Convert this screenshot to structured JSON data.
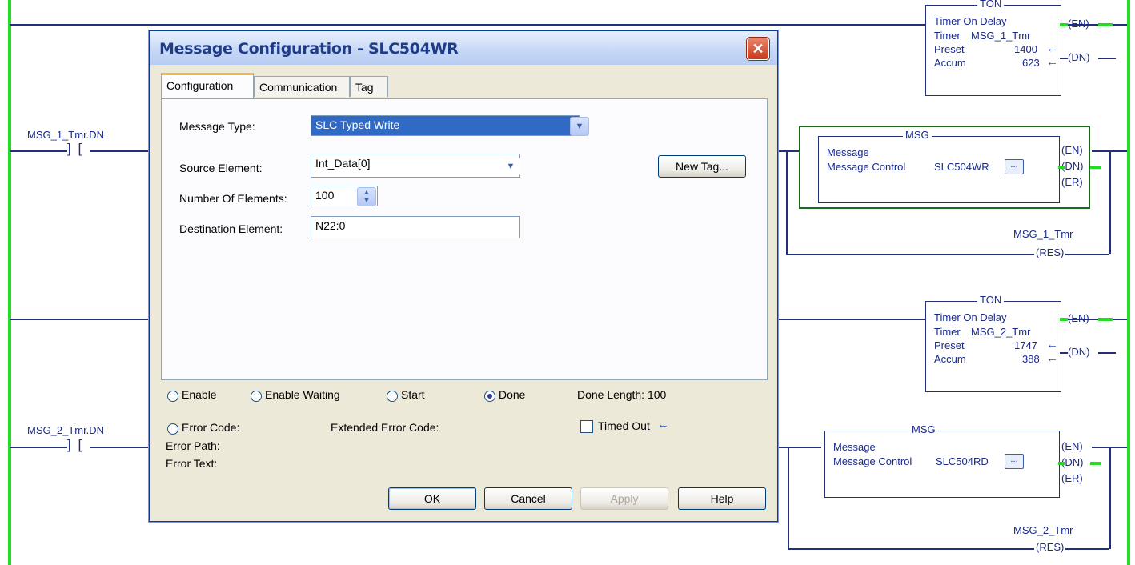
{
  "ladder": {
    "rung1_contact_label": "MSG_1_Tmr.DN",
    "rung2_contact_label": "MSG_2_Tmr.DN",
    "contact_symbol": "] [",
    "ton1": {
      "header": "TON",
      "title": "Timer On Delay",
      "timer_label": "Timer",
      "timer_tag": "MSG_1_Tmr",
      "preset_label": "Preset",
      "preset_value": "1400",
      "accum_label": "Accum",
      "accum_value": "623",
      "en": "(EN)",
      "dn": "(DN)"
    },
    "msg1": {
      "header": "MSG",
      "title": "Message",
      "control_label": "Message Control",
      "control_tag": "SLC504WR",
      "en": "(EN)",
      "dn": "(DN)",
      "er": "(ER)",
      "res_tag": "MSG_1_Tmr",
      "res": "(RES)"
    },
    "ton2": {
      "header": "TON",
      "title": "Timer On Delay",
      "timer_label": "Timer",
      "timer_tag": "MSG_2_Tmr",
      "preset_label": "Preset",
      "preset_value": "1747",
      "accum_label": "Accum",
      "accum_value": "388",
      "en": "(EN)",
      "dn": "(DN)"
    },
    "msg2": {
      "header": "MSG",
      "title": "Message",
      "control_label": "Message Control",
      "control_tag": "SLC504RD",
      "en": "(EN)",
      "dn": "(DN)",
      "er": "(ER)",
      "res_tag": "MSG_2_Tmr",
      "res": "(RES)"
    },
    "ellipsis_label": "..."
  },
  "dialog": {
    "title": "Message Configuration - SLC504WR",
    "close_glyph": "✕",
    "tabs": [
      "Configuration",
      "Communication",
      "Tag"
    ],
    "active_tab": "Configuration",
    "message_type_label": "Message Type:",
    "message_type_value": "SLC Typed Write",
    "source_element_label": "Source Element:",
    "source_element_value": "Int_Data[0]",
    "new_tag_button": "New Tag...",
    "number_of_elements_label": "Number Of Elements:",
    "number_of_elements_value": "100",
    "destination_element_label": "Destination Element:",
    "destination_element_value": "N22:0",
    "status": {
      "enable": "Enable",
      "enable_waiting": "Enable Waiting",
      "start": "Start",
      "done": "Done",
      "done_selected": true,
      "done_length": "Done Length: 100",
      "error_code": "Error Code:",
      "extended_error_code": "Extended Error Code:",
      "timed_out": "Timed Out",
      "error_path": "Error Path:",
      "error_text": "Error Text:"
    },
    "buttons": {
      "ok": "OK",
      "cancel": "Cancel",
      "apply": "Apply",
      "help": "Help"
    }
  },
  "colors": {
    "rail_green": "#22dd22",
    "wire_blue": "#22307a",
    "msg_highlight_box": "#1a6a1a",
    "tab_accent": "#f7b64b"
  }
}
